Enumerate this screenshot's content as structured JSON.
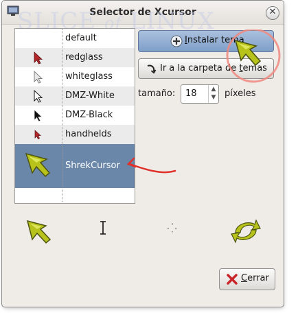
{
  "window": {
    "title": "Selector de Xcursor"
  },
  "watermark": {
    "prefix": "SLICE",
    "mid": "of",
    "suffix": "LINUX"
  },
  "themes": [
    {
      "name": "default",
      "icon": "blank",
      "selected": false
    },
    {
      "name": "redglass",
      "icon": "red-arrow-icon",
      "selected": false
    },
    {
      "name": "whiteglass",
      "icon": "white-arrow-icon",
      "selected": false
    },
    {
      "name": "DMZ-White",
      "icon": "outline-arrow-icon",
      "selected": false
    },
    {
      "name": "DMZ-Black",
      "icon": "black-arrow-icon",
      "selected": false
    },
    {
      "name": "handhelds",
      "icon": "small-red-arrow-icon",
      "selected": false
    },
    {
      "name": "ShrekCursor",
      "icon": "green-arrow-icon",
      "selected": true
    }
  ],
  "buttons": {
    "install": {
      "label_pre": "",
      "label_u": "I",
      "label_post": "nstalar tema"
    },
    "folder": {
      "label_pre": "Ir a la carpeta de ",
      "label_u": "t",
      "label_post": "emas"
    },
    "close": {
      "label_pre": "",
      "label_u": "C",
      "label_post": "errar"
    }
  },
  "size": {
    "label": "tamaño:",
    "value": "18",
    "unit": "píxeles"
  },
  "colors": {
    "selection": "#6a86a8",
    "annotation": "#e0302a"
  }
}
